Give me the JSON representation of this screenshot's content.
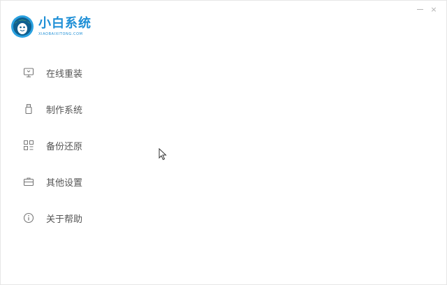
{
  "app": {
    "logo_title": "小白系统",
    "logo_subtitle": "XIAOBAIXITONG.COM",
    "brand_color": "#1e8fd6"
  },
  "window_controls": {
    "minimize_icon": "minimize-icon",
    "close_glyph": "×"
  },
  "sidebar": {
    "items": [
      {
        "label": "在线重装",
        "icon": "monitor-icon"
      },
      {
        "label": "制作系统",
        "icon": "usb-drive-icon"
      },
      {
        "label": "备份还原",
        "icon": "grid-icon"
      },
      {
        "label": "其他设置",
        "icon": "toolbox-icon"
      },
      {
        "label": "关于帮助",
        "icon": "info-icon"
      }
    ]
  }
}
